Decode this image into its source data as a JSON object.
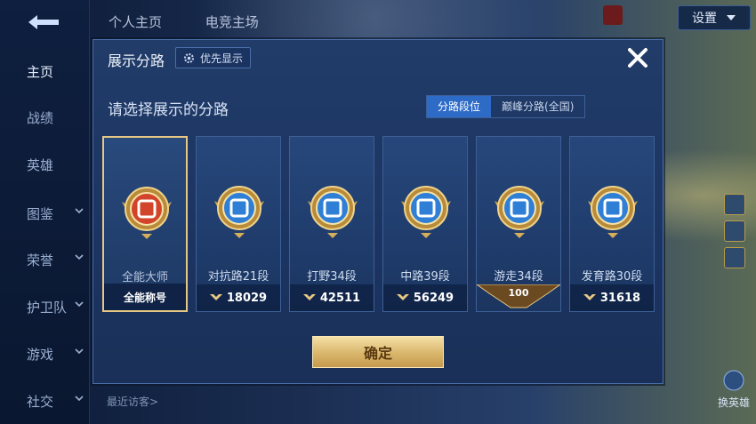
{
  "sidebar": {
    "items": [
      {
        "label": "主页",
        "active": true,
        "expandable": false
      },
      {
        "label": "战绩",
        "active": false,
        "expandable": false
      },
      {
        "label": "英雄",
        "active": false,
        "expandable": false
      },
      {
        "label": "图鉴",
        "active": false,
        "expandable": true
      },
      {
        "label": "荣誉",
        "active": false,
        "expandable": true
      },
      {
        "label": "护卫队",
        "active": false,
        "expandable": true
      },
      {
        "label": "游戏",
        "active": false,
        "expandable": true
      },
      {
        "label": "社交",
        "active": false,
        "expandable": true
      }
    ]
  },
  "header": {
    "tabs": [
      "个人主页",
      "电竞主场"
    ],
    "settings_label": "设置"
  },
  "bottom": {
    "visitors_label": "最近访客>",
    "switch_label": "换英雄"
  },
  "modal": {
    "title": "展示分路",
    "priority_label": "优先显示",
    "prompt": "请选择展示的分路",
    "toggle": [
      {
        "label": "分路段位",
        "active": true
      },
      {
        "label": "巅峰分路(全国)",
        "active": false
      }
    ],
    "confirm_label": "确定",
    "cards": [
      {
        "name": "全能大师",
        "foot_text": "全能称号",
        "foot_type": "plain",
        "selected": true,
        "emblem": "all-round-emblem-icon",
        "accent": "#d2452a"
      },
      {
        "name": "对抗路21段",
        "foot_text": "18029",
        "foot_type": "score",
        "selected": false,
        "emblem": "clash-lane-emblem-icon",
        "accent": "#2f7fd6"
      },
      {
        "name": "打野34段",
        "foot_text": "42511",
        "foot_type": "score",
        "selected": false,
        "emblem": "jungle-emblem-icon",
        "accent": "#2f7fd6"
      },
      {
        "name": "中路39段",
        "foot_text": "56249",
        "foot_type": "score",
        "selected": false,
        "emblem": "mid-lane-emblem-icon",
        "accent": "#2f7fd6"
      },
      {
        "name": "游走34段",
        "foot_text": "100",
        "foot_type": "badge",
        "selected": false,
        "emblem": "roam-emblem-icon",
        "accent": "#2f7fd6"
      },
      {
        "name": "发育路30段",
        "foot_text": "31618",
        "foot_type": "score",
        "selected": false,
        "emblem": "farm-lane-emblem-icon",
        "accent": "#2f7fd6"
      }
    ]
  },
  "colors": {
    "gold": "#e8c783",
    "toggle_active": "#2e6bc7",
    "panel": "#1c3462"
  }
}
